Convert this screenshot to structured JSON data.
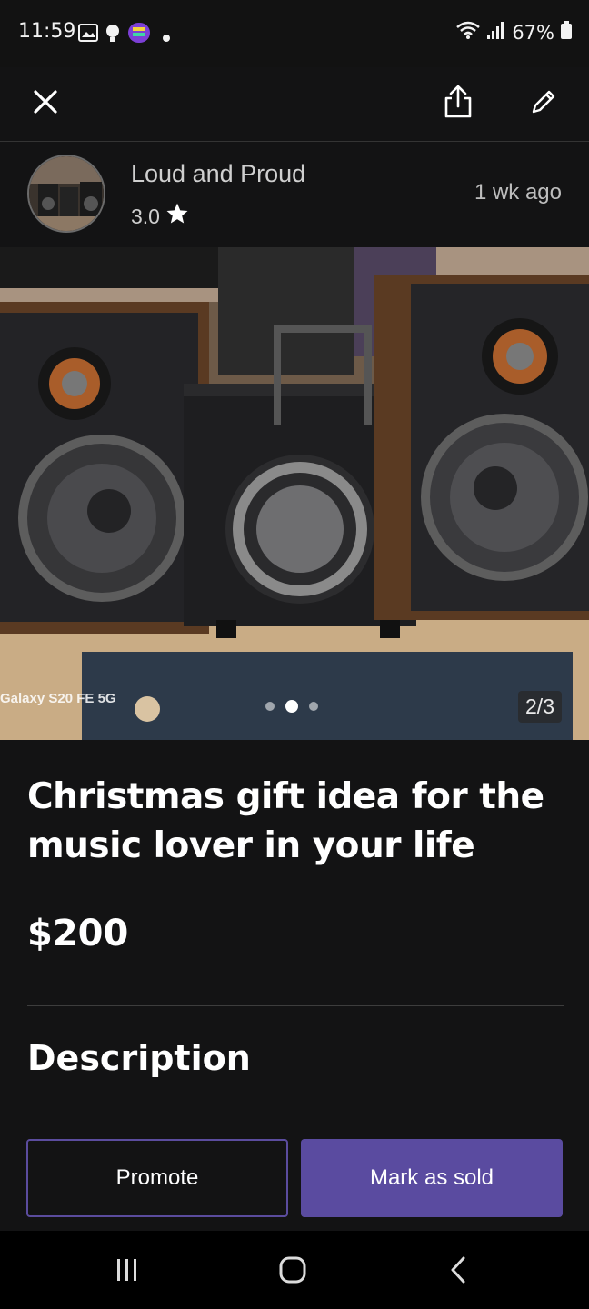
{
  "status_bar": {
    "time": "11:59",
    "battery": "67%",
    "icons": [
      "gallery-icon",
      "bulb-icon",
      "app-icon",
      "dot-icon",
      "wifi-icon",
      "signal-icon",
      "battery-icon"
    ]
  },
  "app_bar": {
    "icons": [
      "close-icon",
      "share-icon",
      "edit-icon"
    ]
  },
  "seller": {
    "name": "Loud and Proud",
    "rating": "3.0",
    "posted": "1 wk  ago"
  },
  "photo": {
    "watermark": "Galaxy S20 FE 5G",
    "counter": "2/3",
    "current_index": 2,
    "total": 3
  },
  "listing": {
    "title": "Christmas gift idea for the music lover in your life",
    "price": "$200",
    "description_heading": "Description"
  },
  "actions": {
    "promote_label": "Promote",
    "mark_sold_label": "Mark as sold"
  },
  "colors": {
    "background": "#131314",
    "accent": "#5a4ba0",
    "accent_border": "#5b4c9e"
  },
  "nav_bar": {
    "icons": [
      "recent-apps-icon",
      "home-icon",
      "back-icon"
    ]
  }
}
